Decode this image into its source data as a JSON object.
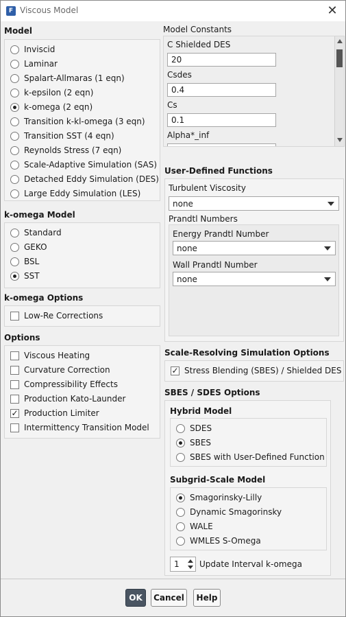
{
  "window": {
    "title": "Viscous Model",
    "app_icon": "fluent-app-icon"
  },
  "model": {
    "title": "Model",
    "options": [
      {
        "label": "Inviscid",
        "selected": false
      },
      {
        "label": "Laminar",
        "selected": false
      },
      {
        "label": "Spalart-Allmaras (1 eqn)",
        "selected": false
      },
      {
        "label": "k-epsilon (2 eqn)",
        "selected": false
      },
      {
        "label": "k-omega (2 eqn)",
        "selected": true
      },
      {
        "label": "Transition k-kl-omega (3 eqn)",
        "selected": false
      },
      {
        "label": "Transition SST (4 eqn)",
        "selected": false
      },
      {
        "label": "Reynolds Stress (7 eqn)",
        "selected": false
      },
      {
        "label": "Scale-Adaptive Simulation (SAS)",
        "selected": false
      },
      {
        "label": "Detached Eddy Simulation (DES)",
        "selected": false
      },
      {
        "label": "Large Eddy Simulation (LES)",
        "selected": false
      }
    ]
  },
  "komega_model": {
    "title": "k-omega Model",
    "options": [
      {
        "label": "Standard",
        "selected": false
      },
      {
        "label": "GEKO",
        "selected": false
      },
      {
        "label": "BSL",
        "selected": false
      },
      {
        "label": "SST",
        "selected": true
      }
    ]
  },
  "komega_options": {
    "title": "k-omega Options",
    "options": [
      {
        "label": "Low-Re Corrections",
        "checked": false
      }
    ]
  },
  "options": {
    "title": "Options",
    "options": [
      {
        "label": "Viscous Heating",
        "checked": false
      },
      {
        "label": "Curvature Correction",
        "checked": false
      },
      {
        "label": "Compressibility Effects",
        "checked": false
      },
      {
        "label": "Production Kato-Launder",
        "checked": false
      },
      {
        "label": "Production Limiter",
        "checked": true
      },
      {
        "label": "Intermittency Transition Model",
        "checked": false
      }
    ]
  },
  "model_constants": {
    "title": "Model Constants",
    "items": [
      {
        "label": "C Shielded DES",
        "value": "20"
      },
      {
        "label": "Csdes",
        "value": "0.4"
      },
      {
        "label": "Cs",
        "value": "0.1"
      },
      {
        "label": "Alpha*_inf",
        "value": ""
      }
    ]
  },
  "udf": {
    "title": "User-Defined Functions",
    "turbulent_viscosity_label": "Turbulent Viscosity",
    "turbulent_viscosity_value": "none",
    "prandtl_title": "Prandtl Numbers",
    "energy_label": "Energy Prandtl Number",
    "energy_value": "none",
    "wall_label": "Wall Prandtl Number",
    "wall_value": "none"
  },
  "srs_options": {
    "title": "Scale-Resolving Simulation Options",
    "stress_blending_label": "Stress Blending (SBES) / Shielded DES",
    "stress_blending_checked": true
  },
  "sbes": {
    "title": "SBES / SDES Options",
    "hybrid_title": "Hybrid Model",
    "hybrid_options": [
      {
        "label": "SDES",
        "selected": false
      },
      {
        "label": "SBES",
        "selected": true
      },
      {
        "label": "SBES with User-Defined Function",
        "selected": false
      }
    ],
    "subgrid_title": "Subgrid-Scale Model",
    "subgrid_options": [
      {
        "label": "Smagorinsky-Lilly",
        "selected": true
      },
      {
        "label": "Dynamic Smagorinsky",
        "selected": false
      },
      {
        "label": "WALE",
        "selected": false
      },
      {
        "label": "WMLES S-Omega",
        "selected": false
      }
    ],
    "update_interval_value": "1",
    "update_interval_label": "Update Interval k-omega"
  },
  "buttons": {
    "ok": "OK",
    "cancel": "Cancel",
    "help": "Help"
  }
}
